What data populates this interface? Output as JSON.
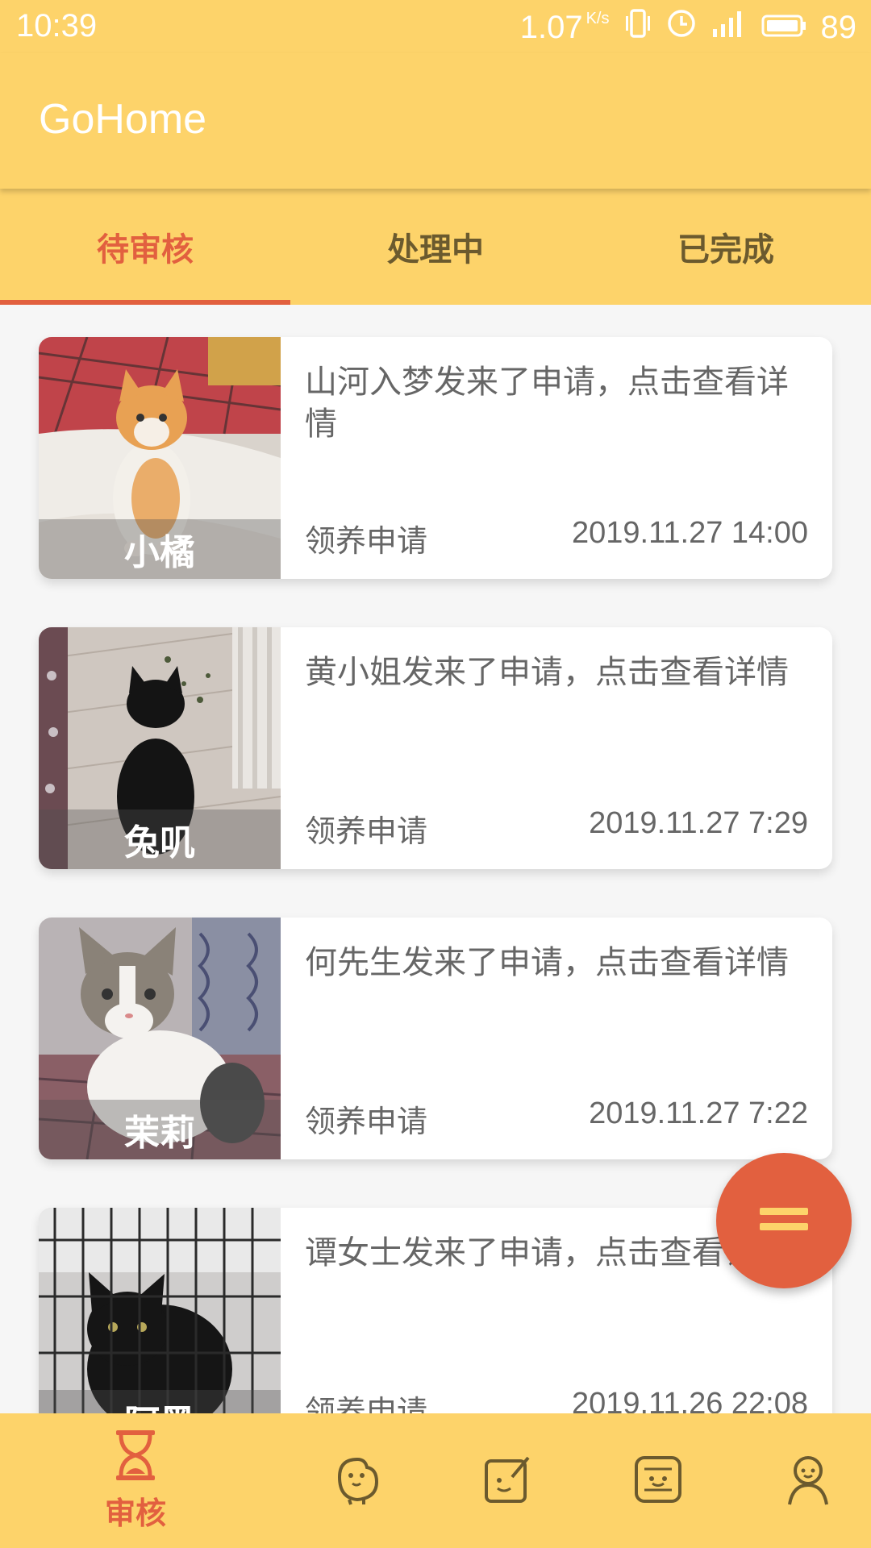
{
  "status_bar": {
    "time": "10:39",
    "speed": "1.07",
    "speed_unit": "K/s",
    "battery": "89"
  },
  "app": {
    "title": "GoHome"
  },
  "tabs": [
    {
      "label": "待审核",
      "active": true
    },
    {
      "label": "处理中",
      "active": false
    },
    {
      "label": "已完成",
      "active": false
    }
  ],
  "cards": [
    {
      "pet_name": "小橘",
      "message": "山河入梦发来了申请，点击查看详情",
      "type": "领养申请",
      "time": "2019.11.27 14:00"
    },
    {
      "pet_name": "兔叽",
      "message": "黄小姐发来了申请，点击查看详情",
      "type": "领养申请",
      "time": "2019.11.27 7:29"
    },
    {
      "pet_name": "茉莉",
      "message": "何先生发来了申请，点击查看详情",
      "type": "领养申请",
      "time": "2019.11.27 7:22"
    },
    {
      "pet_name": "阿黑",
      "message": "谭女士发来了申请，点击查看详情",
      "type": "领养申请",
      "time": "2019.11.26 22:08"
    }
  ],
  "bottom_nav": {
    "items": [
      {
        "label": "审核",
        "icon": "hourglass-icon",
        "active": true
      },
      {
        "icon": "pet-icon"
      },
      {
        "icon": "edit-icon"
      },
      {
        "icon": "chat-face-icon"
      },
      {
        "icon": "profile-icon"
      }
    ]
  },
  "colors": {
    "primary": "#fdd36a",
    "accent": "#e2603f",
    "text_secondary": "#666666"
  }
}
